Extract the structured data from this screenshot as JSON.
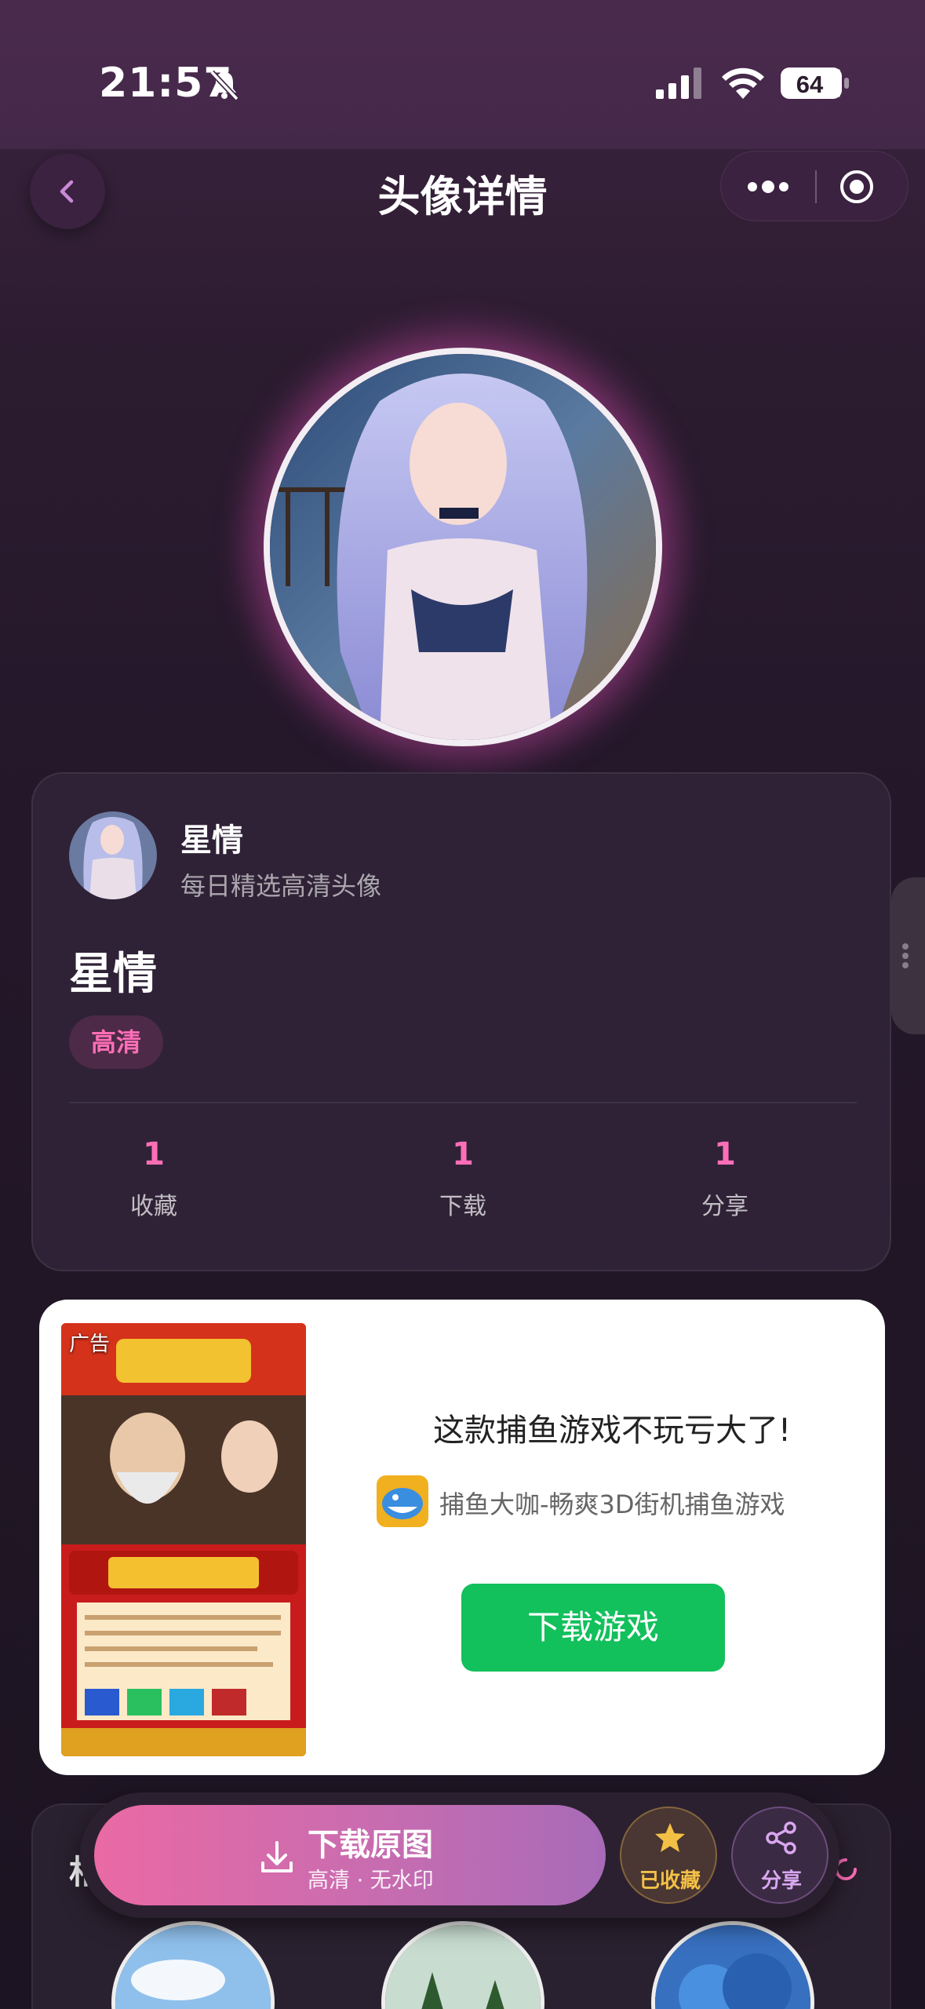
{
  "status_bar": {
    "time": "21:57",
    "battery": "64"
  },
  "nav": {
    "title": "头像详情"
  },
  "author": {
    "name": "星情",
    "description": "每日精选高清头像"
  },
  "detail": {
    "title": "星情",
    "tag": "高清",
    "stats": [
      {
        "value": "1",
        "label": "收藏"
      },
      {
        "value": "1",
        "label": "下载"
      },
      {
        "value": "1",
        "label": "分享"
      }
    ]
  },
  "ad": {
    "label": "广告",
    "headline": "这款捕鱼游戏不玩亏大了!",
    "app_name": "捕鱼大咖-畅爽3D街机捕鱼游戏",
    "button": "下载游戏"
  },
  "related": {
    "title_fragment": "相"
  },
  "actions": {
    "download_main": "下载原图",
    "download_sub": "高清 · 无水印",
    "favorite": "已收藏",
    "share": "分享"
  },
  "colors": {
    "accent": "#ff6eb7",
    "ad_button": "#12c05c",
    "favorite": "#f3c046"
  }
}
